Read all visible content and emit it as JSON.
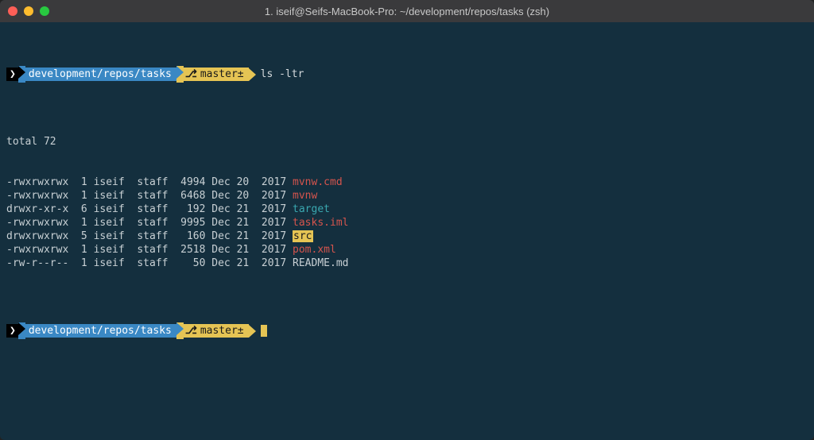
{
  "window": {
    "title": "1. iseif@Seifs-MacBook-Pro: ~/development/repos/tasks (zsh)"
  },
  "prompt1": {
    "path": "development/repos/tasks",
    "branch_label": "master±",
    "command": "ls -ltr"
  },
  "output": {
    "total_line": "total 72",
    "rows": [
      {
        "perm": "-rwxrwxrwx",
        "links": "1",
        "owner": "iseif",
        "group": "staff",
        "size": "4994",
        "date": "Dec 20  2017",
        "name": "mvnw.cmd",
        "style": "fn-red"
      },
      {
        "perm": "-rwxrwxrwx",
        "links": "1",
        "owner": "iseif",
        "group": "staff",
        "size": "6468",
        "date": "Dec 20  2017",
        "name": "mvnw",
        "style": "fn-red"
      },
      {
        "perm": "drwxr-xr-x",
        "links": "6",
        "owner": "iseif",
        "group": "staff",
        "size": "192",
        "date": "Dec 21  2017",
        "name": "target",
        "style": "fn-cyan"
      },
      {
        "perm": "-rwxrwxrwx",
        "links": "1",
        "owner": "iseif",
        "group": "staff",
        "size": "9995",
        "date": "Dec 21  2017",
        "name": "tasks.iml",
        "style": "fn-red"
      },
      {
        "perm": "drwxrwxrwx",
        "links": "5",
        "owner": "iseif",
        "group": "staff",
        "size": "160",
        "date": "Dec 21  2017",
        "name": "src",
        "style": "fn-src"
      },
      {
        "perm": "-rwxrwxrwx",
        "links": "1",
        "owner": "iseif",
        "group": "staff",
        "size": "2518",
        "date": "Dec 21  2017",
        "name": "pom.xml",
        "style": "fn-red"
      },
      {
        "perm": "-rw-r--r--",
        "links": "1",
        "owner": "iseif",
        "group": "staff",
        "size": "50",
        "date": "Dec 21  2017",
        "name": "README.md",
        "style": "fn-white"
      }
    ]
  },
  "prompt2": {
    "path": "development/repos/tasks",
    "branch_label": "master±"
  }
}
